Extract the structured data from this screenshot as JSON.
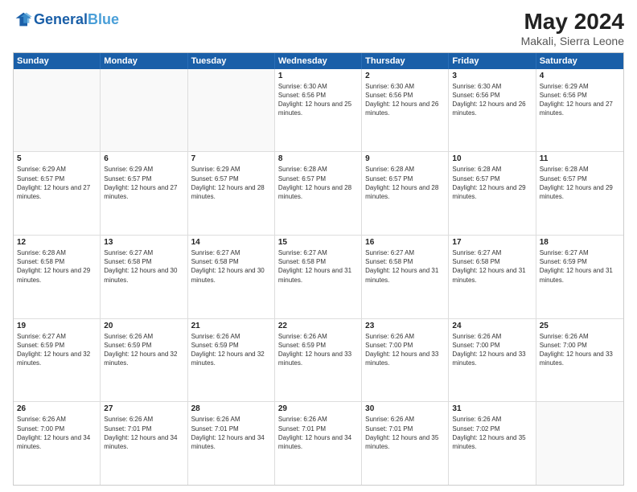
{
  "header": {
    "logo_general": "General",
    "logo_blue": "Blue",
    "month_year": "May 2024",
    "location": "Makali, Sierra Leone"
  },
  "days_of_week": [
    "Sunday",
    "Monday",
    "Tuesday",
    "Wednesday",
    "Thursday",
    "Friday",
    "Saturday"
  ],
  "weeks": [
    [
      {
        "day": "",
        "info": ""
      },
      {
        "day": "",
        "info": ""
      },
      {
        "day": "",
        "info": ""
      },
      {
        "day": "1",
        "info": "Sunrise: 6:30 AM\nSunset: 6:56 PM\nDaylight: 12 hours and 25 minutes."
      },
      {
        "day": "2",
        "info": "Sunrise: 6:30 AM\nSunset: 6:56 PM\nDaylight: 12 hours and 26 minutes."
      },
      {
        "day": "3",
        "info": "Sunrise: 6:30 AM\nSunset: 6:56 PM\nDaylight: 12 hours and 26 minutes."
      },
      {
        "day": "4",
        "info": "Sunrise: 6:29 AM\nSunset: 6:56 PM\nDaylight: 12 hours and 27 minutes."
      }
    ],
    [
      {
        "day": "5",
        "info": "Sunrise: 6:29 AM\nSunset: 6:57 PM\nDaylight: 12 hours and 27 minutes."
      },
      {
        "day": "6",
        "info": "Sunrise: 6:29 AM\nSunset: 6:57 PM\nDaylight: 12 hours and 27 minutes."
      },
      {
        "day": "7",
        "info": "Sunrise: 6:29 AM\nSunset: 6:57 PM\nDaylight: 12 hours and 28 minutes."
      },
      {
        "day": "8",
        "info": "Sunrise: 6:28 AM\nSunset: 6:57 PM\nDaylight: 12 hours and 28 minutes."
      },
      {
        "day": "9",
        "info": "Sunrise: 6:28 AM\nSunset: 6:57 PM\nDaylight: 12 hours and 28 minutes."
      },
      {
        "day": "10",
        "info": "Sunrise: 6:28 AM\nSunset: 6:57 PM\nDaylight: 12 hours and 29 minutes."
      },
      {
        "day": "11",
        "info": "Sunrise: 6:28 AM\nSunset: 6:57 PM\nDaylight: 12 hours and 29 minutes."
      }
    ],
    [
      {
        "day": "12",
        "info": "Sunrise: 6:28 AM\nSunset: 6:58 PM\nDaylight: 12 hours and 29 minutes."
      },
      {
        "day": "13",
        "info": "Sunrise: 6:27 AM\nSunset: 6:58 PM\nDaylight: 12 hours and 30 minutes."
      },
      {
        "day": "14",
        "info": "Sunrise: 6:27 AM\nSunset: 6:58 PM\nDaylight: 12 hours and 30 minutes."
      },
      {
        "day": "15",
        "info": "Sunrise: 6:27 AM\nSunset: 6:58 PM\nDaylight: 12 hours and 31 minutes."
      },
      {
        "day": "16",
        "info": "Sunrise: 6:27 AM\nSunset: 6:58 PM\nDaylight: 12 hours and 31 minutes."
      },
      {
        "day": "17",
        "info": "Sunrise: 6:27 AM\nSunset: 6:58 PM\nDaylight: 12 hours and 31 minutes."
      },
      {
        "day": "18",
        "info": "Sunrise: 6:27 AM\nSunset: 6:59 PM\nDaylight: 12 hours and 31 minutes."
      }
    ],
    [
      {
        "day": "19",
        "info": "Sunrise: 6:27 AM\nSunset: 6:59 PM\nDaylight: 12 hours and 32 minutes."
      },
      {
        "day": "20",
        "info": "Sunrise: 6:26 AM\nSunset: 6:59 PM\nDaylight: 12 hours and 32 minutes."
      },
      {
        "day": "21",
        "info": "Sunrise: 6:26 AM\nSunset: 6:59 PM\nDaylight: 12 hours and 32 minutes."
      },
      {
        "day": "22",
        "info": "Sunrise: 6:26 AM\nSunset: 6:59 PM\nDaylight: 12 hours and 33 minutes."
      },
      {
        "day": "23",
        "info": "Sunrise: 6:26 AM\nSunset: 7:00 PM\nDaylight: 12 hours and 33 minutes."
      },
      {
        "day": "24",
        "info": "Sunrise: 6:26 AM\nSunset: 7:00 PM\nDaylight: 12 hours and 33 minutes."
      },
      {
        "day": "25",
        "info": "Sunrise: 6:26 AM\nSunset: 7:00 PM\nDaylight: 12 hours and 33 minutes."
      }
    ],
    [
      {
        "day": "26",
        "info": "Sunrise: 6:26 AM\nSunset: 7:00 PM\nDaylight: 12 hours and 34 minutes."
      },
      {
        "day": "27",
        "info": "Sunrise: 6:26 AM\nSunset: 7:01 PM\nDaylight: 12 hours and 34 minutes."
      },
      {
        "day": "28",
        "info": "Sunrise: 6:26 AM\nSunset: 7:01 PM\nDaylight: 12 hours and 34 minutes."
      },
      {
        "day": "29",
        "info": "Sunrise: 6:26 AM\nSunset: 7:01 PM\nDaylight: 12 hours and 34 minutes."
      },
      {
        "day": "30",
        "info": "Sunrise: 6:26 AM\nSunset: 7:01 PM\nDaylight: 12 hours and 35 minutes."
      },
      {
        "day": "31",
        "info": "Sunrise: 6:26 AM\nSunset: 7:02 PM\nDaylight: 12 hours and 35 minutes."
      },
      {
        "day": "",
        "info": ""
      }
    ]
  ]
}
